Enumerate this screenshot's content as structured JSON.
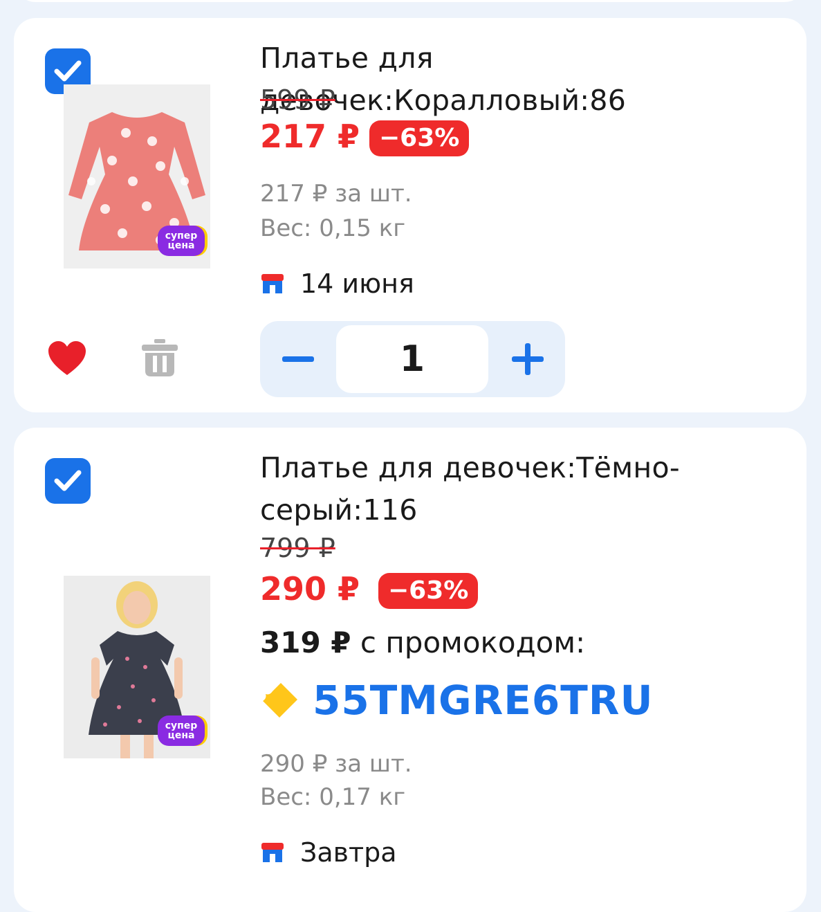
{
  "items": [
    {
      "title": "Платье для девочек:Коралловый:86",
      "old_price": "599 ₽",
      "price": "217 ₽",
      "discount": "−63%",
      "per_unit": "217 ₽ за шт.",
      "weight": "Вес: 0,15 кг",
      "delivery": "14 июня",
      "quantity": "1",
      "sticker": "супер цена",
      "checked": true,
      "favorite": true
    },
    {
      "title": "Платье для девочек:Тёмно-серый:116",
      "old_price": "799 ₽",
      "price": "290 ₽",
      "discount": "−63%",
      "promo_price": "319 ₽",
      "promo_label": "с промокодом:",
      "promo_code": "55TMGRE6TRU",
      "per_unit": "290 ₽ за шт.",
      "weight": "Вес: 0,17 кг",
      "delivery": "Завтра",
      "sticker": "супер цена",
      "checked": true
    }
  ],
  "colors": {
    "accent": "#1a72e8",
    "price_red": "#ef2b2b",
    "favorite": "#e8202a",
    "promo_icon": "#ffc61a"
  },
  "icons": [
    "checkbox-checked-icon",
    "heart-icon",
    "trash-icon",
    "store-icon",
    "minus-icon",
    "plus-icon",
    "ticket-icon"
  ]
}
